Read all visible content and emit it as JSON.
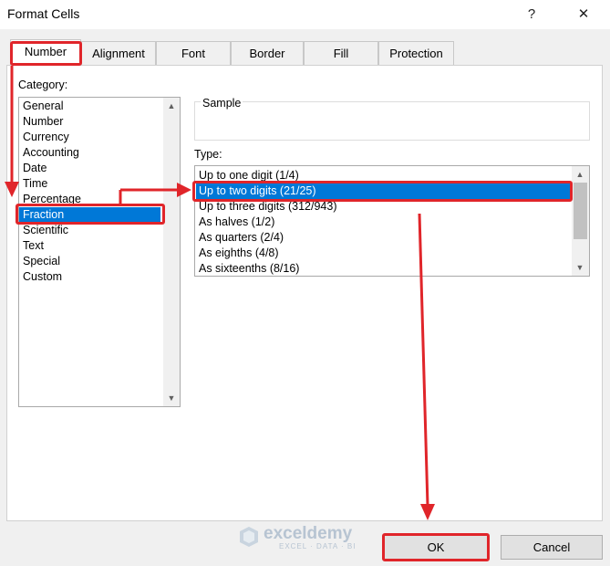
{
  "window": {
    "title": "Format Cells",
    "help": "?",
    "close": "✕"
  },
  "tabs": [
    "Number",
    "Alignment",
    "Font",
    "Border",
    "Fill",
    "Protection"
  ],
  "category": {
    "label": "Category:",
    "items": [
      "General",
      "Number",
      "Currency",
      "Accounting",
      "Date",
      "Time",
      "Percentage",
      "Fraction",
      "Scientific",
      "Text",
      "Special",
      "Custom"
    ],
    "selected": "Fraction"
  },
  "sample": {
    "label": "Sample"
  },
  "type": {
    "label": "Type:",
    "items": [
      "Up to one digit (1/4)",
      "Up to two digits (21/25)",
      "Up to three digits (312/943)",
      "As halves (1/2)",
      "As quarters (2/4)",
      "As eighths (4/8)",
      "As sixteenths (8/16)"
    ],
    "selected": "Up to two digits (21/25)"
  },
  "buttons": {
    "ok": "OK",
    "cancel": "Cancel"
  },
  "watermark": {
    "name": "exceldemy",
    "tagline": "EXCEL · DATA · BI"
  },
  "colors": {
    "selection": "#0078d7",
    "annotation": "#e0252a"
  }
}
